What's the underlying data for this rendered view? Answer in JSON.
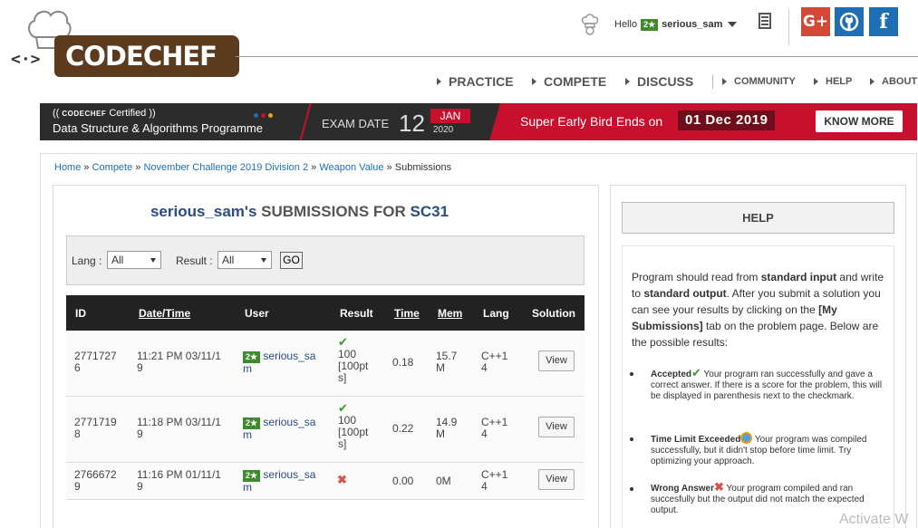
{
  "header": {
    "logo_text": "CODECHEF",
    "logo_face": "<·>",
    "hello": "Hello",
    "star_badge": "2★",
    "username": "serious_sam",
    "social": {
      "gplus": "G+",
      "github": "github-icon",
      "facebook": "f"
    }
  },
  "nav": {
    "main": [
      "PRACTICE",
      "COMPETE",
      "DISCUSS"
    ],
    "secondary": [
      "COMMUNITY",
      "HELP",
      "ABOUT"
    ]
  },
  "promo": {
    "brand": "CODECHEF",
    "certified": "Certified",
    "title": "Data Structure & Algorithms Programme",
    "exam_label": "EXAM DATE",
    "exam_day": "12",
    "exam_month": "JAN",
    "exam_year": "2020",
    "early_bird": "Super Early Bird Ends on",
    "early_date": "01 Dec 2019",
    "cta": "KNOW MORE",
    "colors": {
      "accent": "#c8102e",
      "dark": "#2c2c2c"
    }
  },
  "breadcrumb": {
    "items": [
      "Home",
      "Compete",
      "November Challenge 2019 Division 2",
      "Weapon Value"
    ],
    "current": "Submissions",
    "separator": "»"
  },
  "submissions": {
    "user": "serious_sam's",
    "middle": "SUBMISSIONS FOR",
    "problem_code": "SC31",
    "filter": {
      "lang_label": "Lang :",
      "lang_value": "All",
      "result_label": "Result :",
      "result_value": "All",
      "go": "GO"
    },
    "columns": [
      "ID",
      "Date/Time",
      "User",
      "Result",
      "Time",
      "Mem",
      "Lang",
      "Solution"
    ],
    "rows": [
      {
        "id": [
          "2771727",
          "6"
        ],
        "datetime": [
          "11:21 PM 03/11/1",
          "9"
        ],
        "badge": "2★",
        "user": [
          "serious_sa",
          "m"
        ],
        "result_icon": "✔",
        "result": [
          "100",
          "[100pt",
          "s]"
        ],
        "time": "0.18",
        "mem": [
          "15.7",
          "M"
        ],
        "lang": [
          "C++1",
          "4"
        ],
        "view": "View"
      },
      {
        "id": [
          "2771719",
          "8"
        ],
        "datetime": [
          "11:18 PM 03/11/1",
          "9"
        ],
        "badge": "2★",
        "user": [
          "serious_sa",
          "m"
        ],
        "result_icon": "✔",
        "result": [
          "100",
          "[100pt",
          "s]"
        ],
        "time": "0.22",
        "mem": [
          "14.9",
          "M"
        ],
        "lang": [
          "C++1",
          "4"
        ],
        "view": "View"
      },
      {
        "id": [
          "2766672",
          "9"
        ],
        "datetime": [
          "11:16 PM 01/11/1",
          "9"
        ],
        "badge": "2★",
        "user": [
          "serious_sa",
          "m"
        ],
        "result_icon": "✖",
        "result": [
          "",
          "",
          ""
        ],
        "time": "0.00",
        "mem": [
          "0M",
          ""
        ],
        "lang": [
          "C++1",
          "4"
        ],
        "view": "View"
      }
    ]
  },
  "help": {
    "title": "HELP",
    "intro_1": "Program should read from ",
    "intro_b1": "standard input",
    "intro_2": " and write to ",
    "intro_b2": "standard output",
    "intro_3": ". After you submit a solution you can see your results by clicking on the ",
    "intro_b3": "[My Submissions]",
    "intro_4": " tab on the problem page. Below are the possible results:",
    "items": [
      {
        "name": "Accepted",
        "icon": "✔",
        "text": " Your program ran successfully and gave a correct answer. If there is a score for the problem, this will be displayed in parenthesis next to the checkmark."
      },
      {
        "name": "Time Limit Exceeded",
        "icon": "clock-icon",
        "text": " Your program was compiled successfully, but it didn't stop before time limit. Try optimizing your approach."
      },
      {
        "name": "Wrong Answer",
        "icon": "✖",
        "text": " Your program compiled and ran succesfully but the output did not match the expected output."
      }
    ]
  },
  "watermark": "Activate W"
}
